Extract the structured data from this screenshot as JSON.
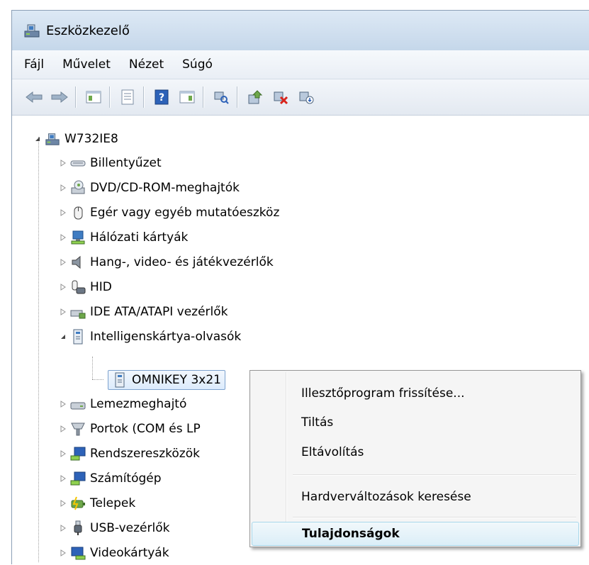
{
  "window": {
    "title": "Eszközkezelő"
  },
  "menu": [
    "Fájl",
    "Művelet",
    "Nézet",
    "Súgó"
  ],
  "toolbar": {
    "buttons": [
      "back-icon",
      "forward-icon",
      "show-hide-console-tree-icon",
      "properties-icon",
      "help-icon",
      "action-pane-icon",
      "scan-hardware-icon",
      "update-driver-icon",
      "uninstall-icon",
      "disable-icon"
    ]
  },
  "tree": {
    "root": "W732IE8",
    "items": [
      "Billentyűzet",
      "DVD/CD-ROM-meghajtók",
      "Egér vagy egyéb mutatóeszköz",
      "Hálózati kártyák",
      "Hang-, video- és játékvezérlők",
      "HID",
      "IDE ATA/ATAPI vezérlők",
      "Intelligenskártya-olvasók",
      "OMNIKEY 3x21",
      "Lemezmeghajtó",
      "Portok (COM és LP",
      "Rendszereszközök",
      "Számítógép",
      "Telepek",
      "USB-vezérlők",
      "Videokártyák"
    ]
  },
  "context_menu": {
    "items": [
      "Illesztőprogram frissítése...",
      "Tiltás",
      "Eltávolítás",
      "Hardverváltozások keresése",
      "Tulajdonságok"
    ]
  }
}
